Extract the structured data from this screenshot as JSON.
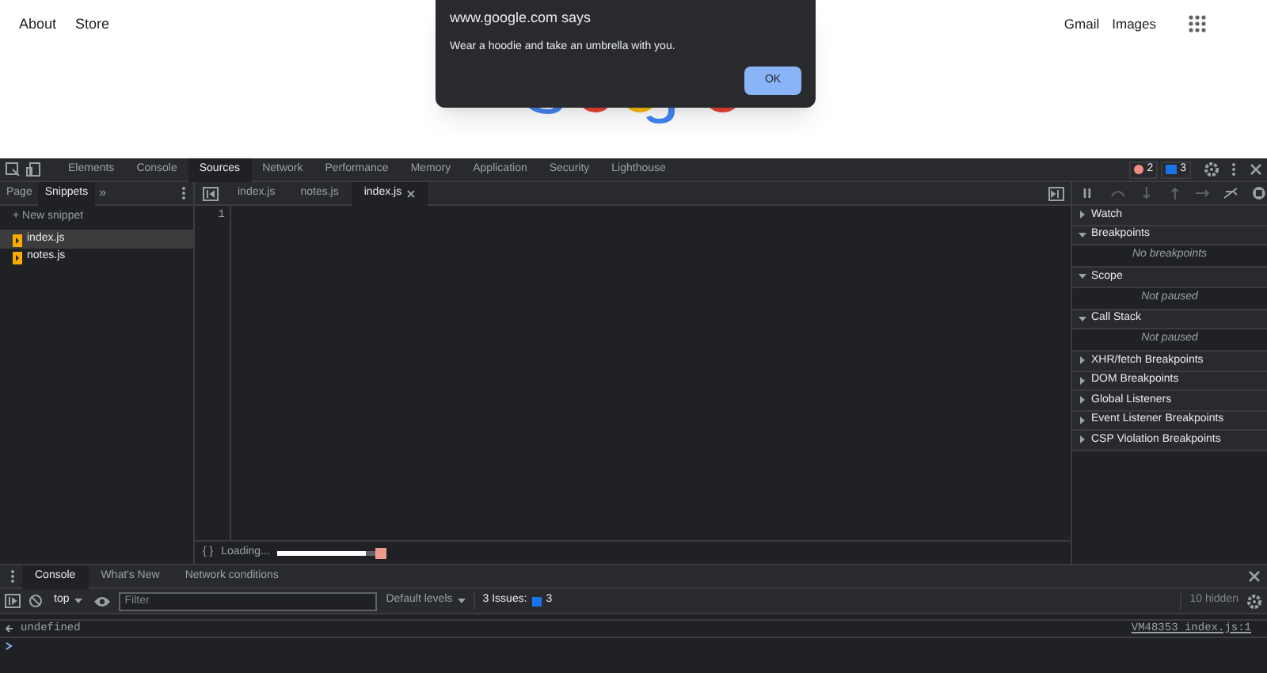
{
  "page": {
    "left_links": [
      "About",
      "Store"
    ],
    "right_links": [
      "Gmail",
      "Images"
    ]
  },
  "dialog": {
    "title": "www.google.com says",
    "message": "Wear a hoodie and take an umbrella with you.",
    "button": "OK"
  },
  "devtools": {
    "panel_tabs": [
      {
        "label": "Elements",
        "selected": false
      },
      {
        "label": "Console",
        "selected": false
      },
      {
        "label": "Sources",
        "selected": true
      },
      {
        "label": "Network",
        "selected": false
      },
      {
        "label": "Performance",
        "selected": false
      },
      {
        "label": "Memory",
        "selected": false
      },
      {
        "label": "Application",
        "selected": false
      },
      {
        "label": "Security",
        "selected": false
      },
      {
        "label": "Lighthouse",
        "selected": false
      }
    ],
    "errors_count": "2",
    "issues_count": "3",
    "navigator_tabs": [
      {
        "label": "Page",
        "selected": false
      },
      {
        "label": "Snippets",
        "selected": true
      }
    ],
    "more_tabs": "»",
    "new_snippet": "+ New snippet",
    "snippets": [
      {
        "name": "index.js",
        "selected": true
      },
      {
        "name": "notes.js",
        "selected": false
      }
    ],
    "editor_tabs": [
      {
        "label": "index.js",
        "selected": false,
        "closable": false
      },
      {
        "label": "notes.js",
        "selected": false,
        "closable": false
      },
      {
        "label": "index.js",
        "selected": true,
        "closable": true
      }
    ],
    "line_numbers": [
      "1"
    ],
    "status": {
      "braces": "{ }",
      "text": "Loading...",
      "level": 0.9
    },
    "debugger_sections": [
      {
        "title": "Watch",
        "expanded": false
      },
      {
        "title": "Breakpoints",
        "expanded": true,
        "message": "No breakpoints"
      },
      {
        "title": "Scope",
        "expanded": true,
        "message": "Not paused"
      },
      {
        "title": "Call Stack",
        "expanded": true,
        "message": "Not paused"
      },
      {
        "title": "XHR/fetch Breakpoints",
        "expanded": false
      },
      {
        "title": "DOM Breakpoints",
        "expanded": false
      },
      {
        "title": "Global Listeners",
        "expanded": false
      },
      {
        "title": "Event Listener Breakpoints",
        "expanded": false
      },
      {
        "title": "CSP Violation Breakpoints",
        "expanded": false
      }
    ]
  },
  "drawer": {
    "tabs": [
      {
        "label": "Console",
        "selected": true
      },
      {
        "label": "What's New",
        "selected": false
      },
      {
        "label": "Network conditions",
        "selected": false
      }
    ],
    "context": "top",
    "filter_placeholder": "Filter",
    "levels": "Default levels",
    "issues_label": "3 Issues:",
    "issues_count": "3",
    "hidden": "10 hidden",
    "messages": [
      {
        "text": "undefined",
        "source": "VM48353 index.js:1"
      }
    ]
  }
}
